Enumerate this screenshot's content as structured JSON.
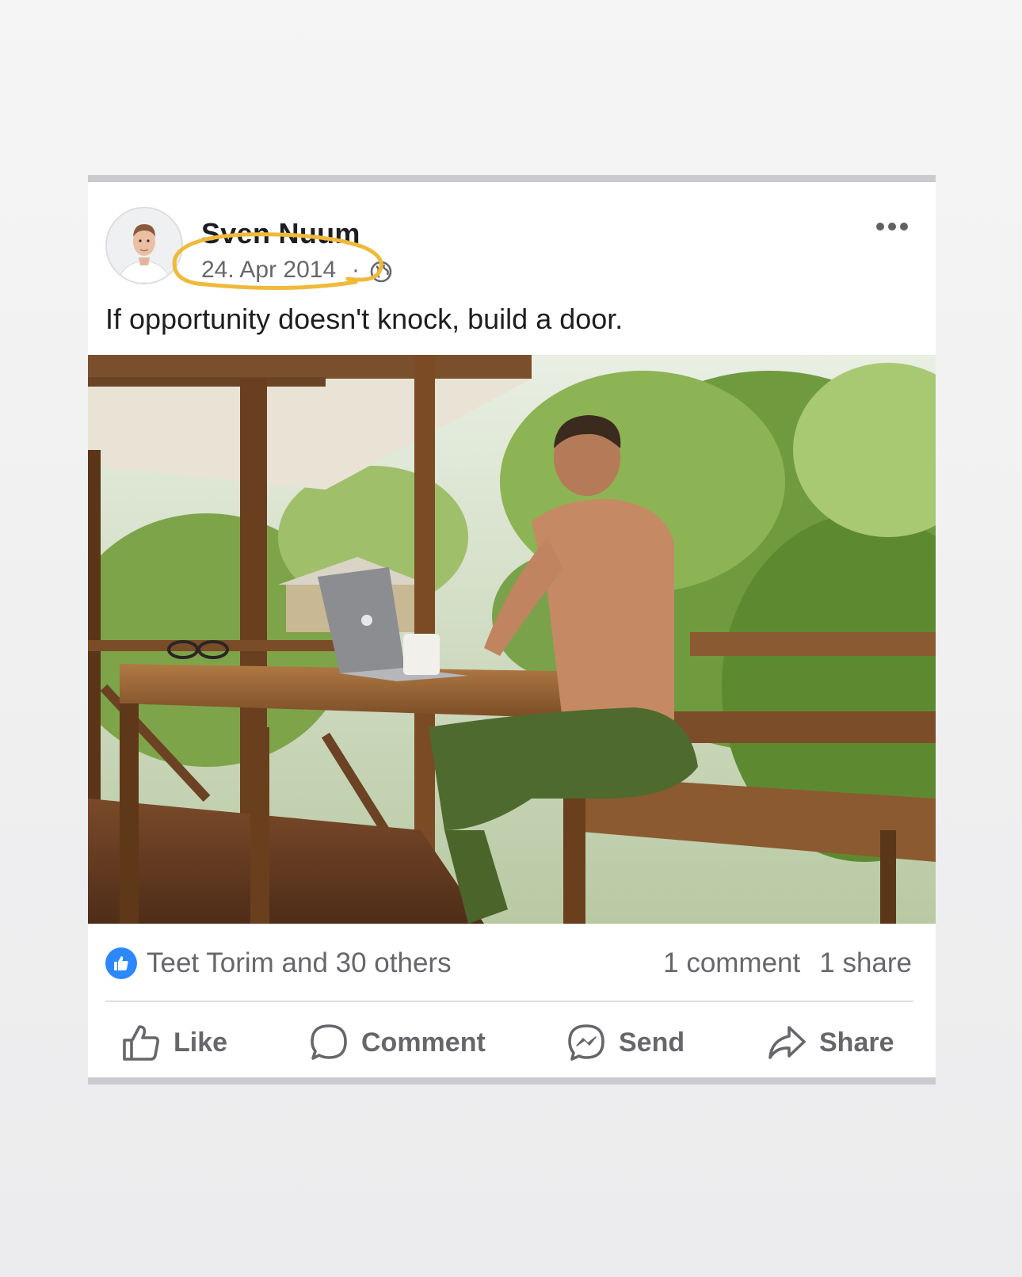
{
  "post": {
    "author": "Sven Nuum",
    "date": "24. Apr 2014",
    "separator": "·",
    "visibility_icon": "globe-icon",
    "more_icon": "more-dots-icon",
    "text": "If opportunity doesn't knock, build a door."
  },
  "footer": {
    "reactions_text": "Teet Torim and 30 others",
    "comments": "1 comment",
    "shares": "1 share"
  },
  "actions": {
    "like": "Like",
    "comment": "Comment",
    "send": "Send",
    "share": "Share"
  },
  "colors": {
    "accent_like": "#2d88ff",
    "highlight": "#f0b93a",
    "secondary_text": "#65676b",
    "primary_text": "#1c1e21"
  }
}
